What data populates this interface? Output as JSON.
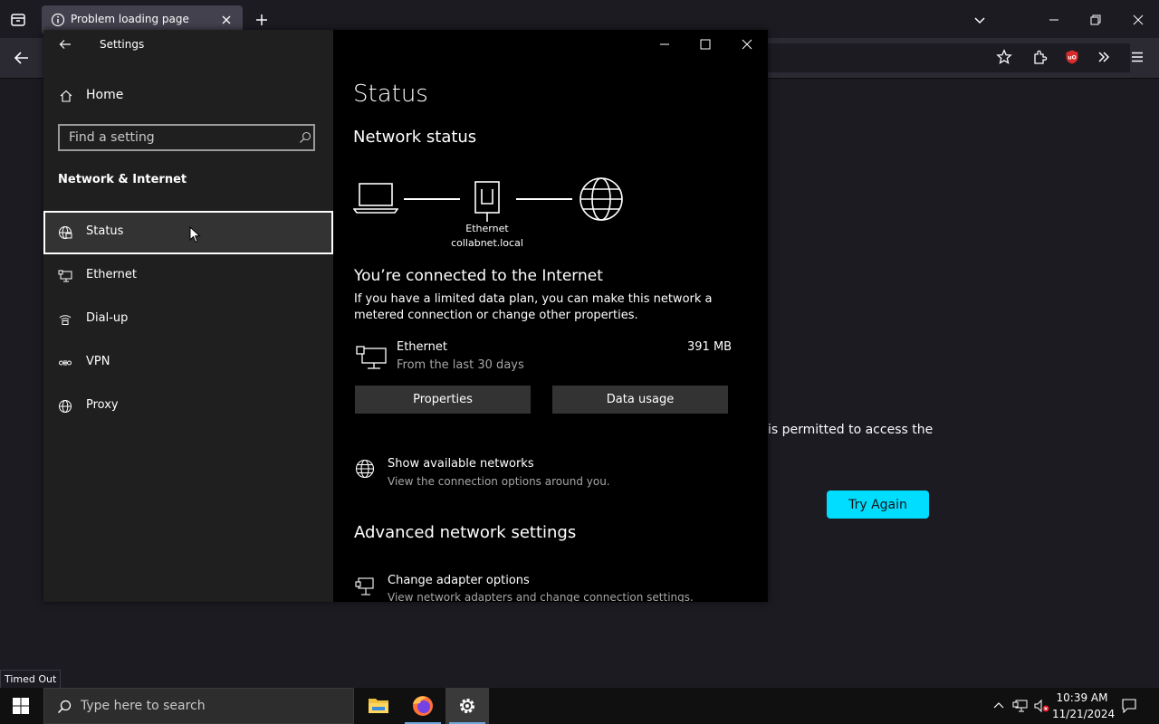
{
  "browser": {
    "tab_title": "Problem loading page",
    "error_fragment": "is permitted to access the",
    "try_again": "Try Again",
    "status_tooltip": "Timed Out",
    "accent": "#00ddff",
    "icons": [
      "tab-view-icon",
      "info-icon",
      "close-icon",
      "plus-icon",
      "chevron-down-icon",
      "minimize-icon",
      "restore-icon",
      "back-arrow-icon",
      "star-icon",
      "puzzle-icon",
      "ublock-icon",
      "double-chevron-icon",
      "hamburger-icon"
    ]
  },
  "settings": {
    "app_title": "Settings",
    "home": "Home",
    "search_placeholder": "Find a setting",
    "section_header": "Network & Internet",
    "nav": [
      {
        "label": "Status",
        "icon": "globe-status-icon",
        "selected": true
      },
      {
        "label": "Ethernet",
        "icon": "ethernet-icon",
        "selected": false
      },
      {
        "label": "Dial-up",
        "icon": "dialup-icon",
        "selected": false
      },
      {
        "label": "VPN",
        "icon": "vpn-icon",
        "selected": false
      },
      {
        "label": "Proxy",
        "icon": "globe-icon",
        "selected": false
      }
    ],
    "page_title": "Status",
    "network_status_heading": "Network status",
    "diagram": {
      "name": "Ethernet",
      "domain": "collabnet.local"
    },
    "connected_heading": "You’re connected to the Internet",
    "connected_desc": "If you have a limited data plan, you can make this network a metered connection or change other properties.",
    "adapter": {
      "name": "Ethernet",
      "period": "From the last 30 days",
      "data": "391 MB"
    },
    "buttons": {
      "properties": "Properties",
      "data_usage": "Data usage"
    },
    "show_networks": {
      "title": "Show available networks",
      "desc": "View the connection options around you."
    },
    "advanced_heading": "Advanced network settings",
    "adapter_options": {
      "title": "Change adapter options",
      "desc": "View network adapters and change connection settings."
    }
  },
  "taskbar": {
    "search_placeholder": "Type here to search",
    "time": "10:39 AM",
    "date": "11/21/2024",
    "apps": [
      "file-explorer",
      "firefox",
      "settings"
    ]
  }
}
